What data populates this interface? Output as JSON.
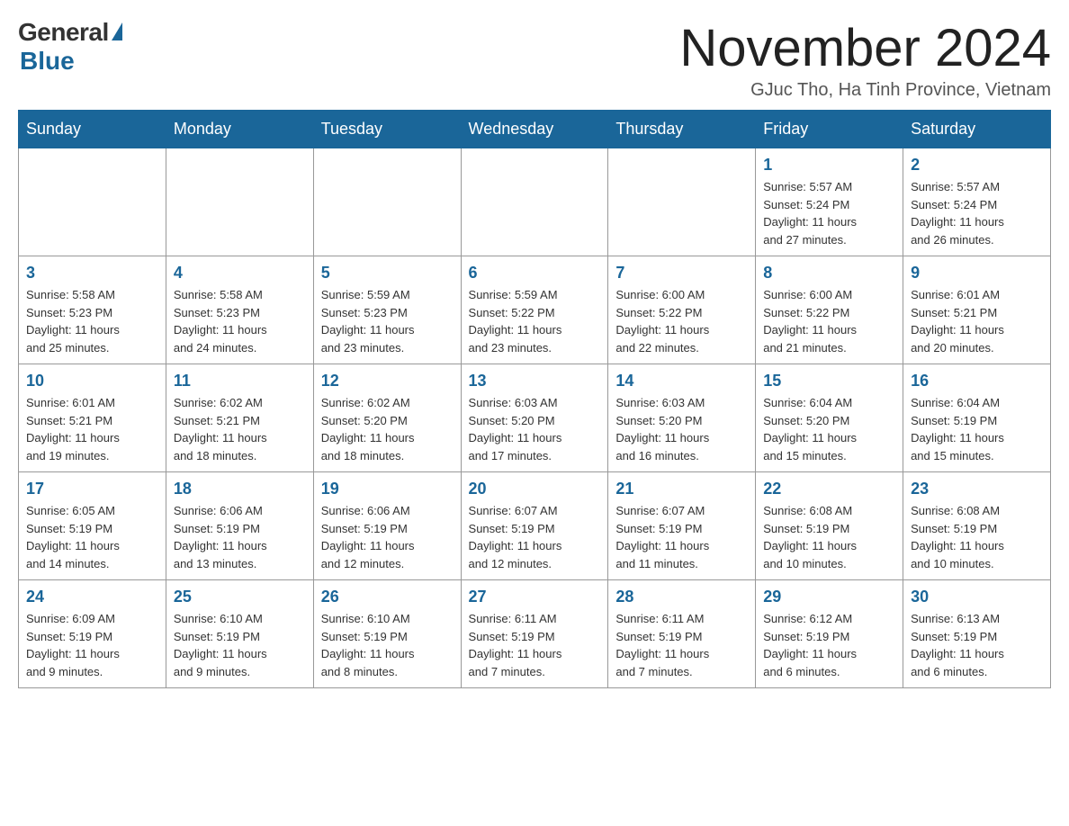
{
  "logo": {
    "general": "General",
    "blue": "Blue"
  },
  "title": "November 2024",
  "location": "GJuc Tho, Ha Tinh Province, Vietnam",
  "weekdays": [
    "Sunday",
    "Monday",
    "Tuesday",
    "Wednesday",
    "Thursday",
    "Friday",
    "Saturday"
  ],
  "weeks": [
    [
      {
        "day": "",
        "info": ""
      },
      {
        "day": "",
        "info": ""
      },
      {
        "day": "",
        "info": ""
      },
      {
        "day": "",
        "info": ""
      },
      {
        "day": "",
        "info": ""
      },
      {
        "day": "1",
        "info": "Sunrise: 5:57 AM\nSunset: 5:24 PM\nDaylight: 11 hours\nand 27 minutes."
      },
      {
        "day": "2",
        "info": "Sunrise: 5:57 AM\nSunset: 5:24 PM\nDaylight: 11 hours\nand 26 minutes."
      }
    ],
    [
      {
        "day": "3",
        "info": "Sunrise: 5:58 AM\nSunset: 5:23 PM\nDaylight: 11 hours\nand 25 minutes."
      },
      {
        "day": "4",
        "info": "Sunrise: 5:58 AM\nSunset: 5:23 PM\nDaylight: 11 hours\nand 24 minutes."
      },
      {
        "day": "5",
        "info": "Sunrise: 5:59 AM\nSunset: 5:23 PM\nDaylight: 11 hours\nand 23 minutes."
      },
      {
        "day": "6",
        "info": "Sunrise: 5:59 AM\nSunset: 5:22 PM\nDaylight: 11 hours\nand 23 minutes."
      },
      {
        "day": "7",
        "info": "Sunrise: 6:00 AM\nSunset: 5:22 PM\nDaylight: 11 hours\nand 22 minutes."
      },
      {
        "day": "8",
        "info": "Sunrise: 6:00 AM\nSunset: 5:22 PM\nDaylight: 11 hours\nand 21 minutes."
      },
      {
        "day": "9",
        "info": "Sunrise: 6:01 AM\nSunset: 5:21 PM\nDaylight: 11 hours\nand 20 minutes."
      }
    ],
    [
      {
        "day": "10",
        "info": "Sunrise: 6:01 AM\nSunset: 5:21 PM\nDaylight: 11 hours\nand 19 minutes."
      },
      {
        "day": "11",
        "info": "Sunrise: 6:02 AM\nSunset: 5:21 PM\nDaylight: 11 hours\nand 18 minutes."
      },
      {
        "day": "12",
        "info": "Sunrise: 6:02 AM\nSunset: 5:20 PM\nDaylight: 11 hours\nand 18 minutes."
      },
      {
        "day": "13",
        "info": "Sunrise: 6:03 AM\nSunset: 5:20 PM\nDaylight: 11 hours\nand 17 minutes."
      },
      {
        "day": "14",
        "info": "Sunrise: 6:03 AM\nSunset: 5:20 PM\nDaylight: 11 hours\nand 16 minutes."
      },
      {
        "day": "15",
        "info": "Sunrise: 6:04 AM\nSunset: 5:20 PM\nDaylight: 11 hours\nand 15 minutes."
      },
      {
        "day": "16",
        "info": "Sunrise: 6:04 AM\nSunset: 5:19 PM\nDaylight: 11 hours\nand 15 minutes."
      }
    ],
    [
      {
        "day": "17",
        "info": "Sunrise: 6:05 AM\nSunset: 5:19 PM\nDaylight: 11 hours\nand 14 minutes."
      },
      {
        "day": "18",
        "info": "Sunrise: 6:06 AM\nSunset: 5:19 PM\nDaylight: 11 hours\nand 13 minutes."
      },
      {
        "day": "19",
        "info": "Sunrise: 6:06 AM\nSunset: 5:19 PM\nDaylight: 11 hours\nand 12 minutes."
      },
      {
        "day": "20",
        "info": "Sunrise: 6:07 AM\nSunset: 5:19 PM\nDaylight: 11 hours\nand 12 minutes."
      },
      {
        "day": "21",
        "info": "Sunrise: 6:07 AM\nSunset: 5:19 PM\nDaylight: 11 hours\nand 11 minutes."
      },
      {
        "day": "22",
        "info": "Sunrise: 6:08 AM\nSunset: 5:19 PM\nDaylight: 11 hours\nand 10 minutes."
      },
      {
        "day": "23",
        "info": "Sunrise: 6:08 AM\nSunset: 5:19 PM\nDaylight: 11 hours\nand 10 minutes."
      }
    ],
    [
      {
        "day": "24",
        "info": "Sunrise: 6:09 AM\nSunset: 5:19 PM\nDaylight: 11 hours\nand 9 minutes."
      },
      {
        "day": "25",
        "info": "Sunrise: 6:10 AM\nSunset: 5:19 PM\nDaylight: 11 hours\nand 9 minutes."
      },
      {
        "day": "26",
        "info": "Sunrise: 6:10 AM\nSunset: 5:19 PM\nDaylight: 11 hours\nand 8 minutes."
      },
      {
        "day": "27",
        "info": "Sunrise: 6:11 AM\nSunset: 5:19 PM\nDaylight: 11 hours\nand 7 minutes."
      },
      {
        "day": "28",
        "info": "Sunrise: 6:11 AM\nSunset: 5:19 PM\nDaylight: 11 hours\nand 7 minutes."
      },
      {
        "day": "29",
        "info": "Sunrise: 6:12 AM\nSunset: 5:19 PM\nDaylight: 11 hours\nand 6 minutes."
      },
      {
        "day": "30",
        "info": "Sunrise: 6:13 AM\nSunset: 5:19 PM\nDaylight: 11 hours\nand 6 minutes."
      }
    ]
  ]
}
